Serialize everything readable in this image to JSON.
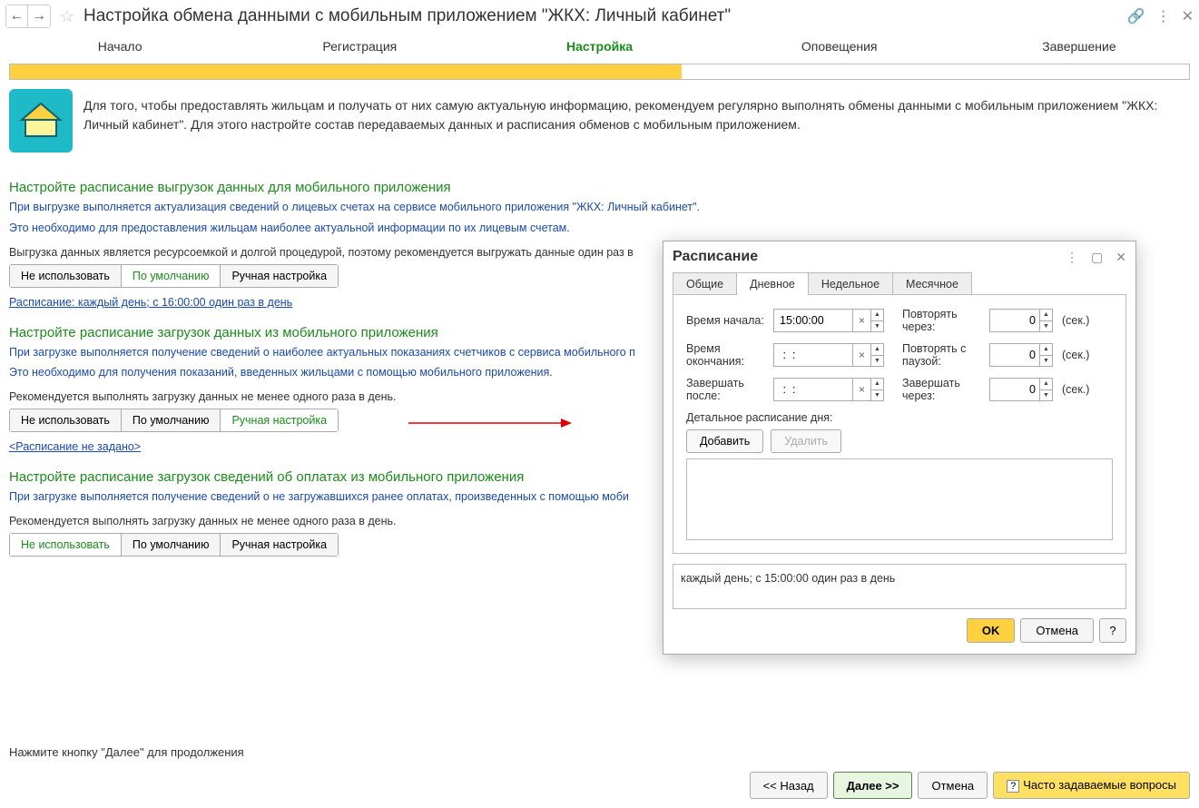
{
  "header": {
    "title": "Настройка обмена данными с мобильным приложением \"ЖКХ: Личный кабинет\""
  },
  "steps": [
    "Начало",
    "Регистрация",
    "Настройка",
    "Оповещения",
    "Завершение"
  ],
  "intro": "Для того, чтобы предоставлять жильцам и получать от них самую актуальную информацию, рекомендуем регулярно выполнять обмены данными с мобильным приложением \"ЖКХ: Личный кабинет\". Для этого настройте состав передаваемых данных и расписания обменов с мобильным приложением.",
  "btns": {
    "none": "Не использовать",
    "default": "По умолчанию",
    "manual": "Ручная настройка"
  },
  "sec1": {
    "title": "Настройте расписание выгрузок данных для мобильного приложения",
    "desc1": "При выгрузке выполняется актуализация сведений о лицевых счетах на сервисе мобильного приложения \"ЖКХ: Личный кабинет\".",
    "desc2": "Это необходимо для предоставления жильцам наиболее актуальной информации по их лицевым счетам.",
    "note": "Выгрузка данных является ресурсоемкой и долгой процедурой, поэтому рекомендуется выгружать данные один раз в",
    "link": "Расписание: каждый день; с 16:00:00 один раз в день"
  },
  "sec2": {
    "title": "Настройте расписание загрузок данных из мобильного приложения",
    "desc1": "При загрузке выполняется получение сведений о наиболее актуальных показаниях счетчиков с сервиса мобильного п",
    "desc2": "Это необходимо для получения показаний, введенных жильцами с помощью мобильного приложения.",
    "note": "Рекомендуется выполнять загрузку данных не менее одного раза в день.",
    "link": "<Расписание не задано>"
  },
  "sec3": {
    "title": "Настройте расписание загрузок сведений об оплатах из мобильного приложения",
    "desc1": "При загрузке выполняется получение сведений о не загружавшихся ранее оплатах, произведенных с помощью моби",
    "note": "Рекомендуется выполнять загрузку данных не менее одного раза в день."
  },
  "footer": {
    "hint": "Нажмите кнопку \"Далее\" для продолжения",
    "back": "<< Назад",
    "next": "Далее >>",
    "cancel": "Отмена",
    "faq": "Часто задаваемые вопросы"
  },
  "dialog": {
    "title": "Расписание",
    "tabs": [
      "Общие",
      "Дневное",
      "Недельное",
      "Месячное"
    ],
    "labels": {
      "start": "Время начала:",
      "end": "Время окончания:",
      "after": "Завершать после:",
      "repeat_every": "Повторять через:",
      "repeat_pause": "Повторять с паузой:",
      "end_every": "Завершать через:",
      "sec": "(сек.)",
      "detail": "Детальное расписание дня:",
      "add": "Добавить",
      "del": "Удалить",
      "ok": "OK",
      "cancel": "Отмена",
      "q": "?"
    },
    "values": {
      "start": "15:00:00",
      "end": " :  : ",
      "after": " :  : ",
      "repeat_every": "0",
      "repeat_pause": "0",
      "end_every": "0"
    },
    "summary": "каждый день; с 15:00:00 один раз в день"
  }
}
